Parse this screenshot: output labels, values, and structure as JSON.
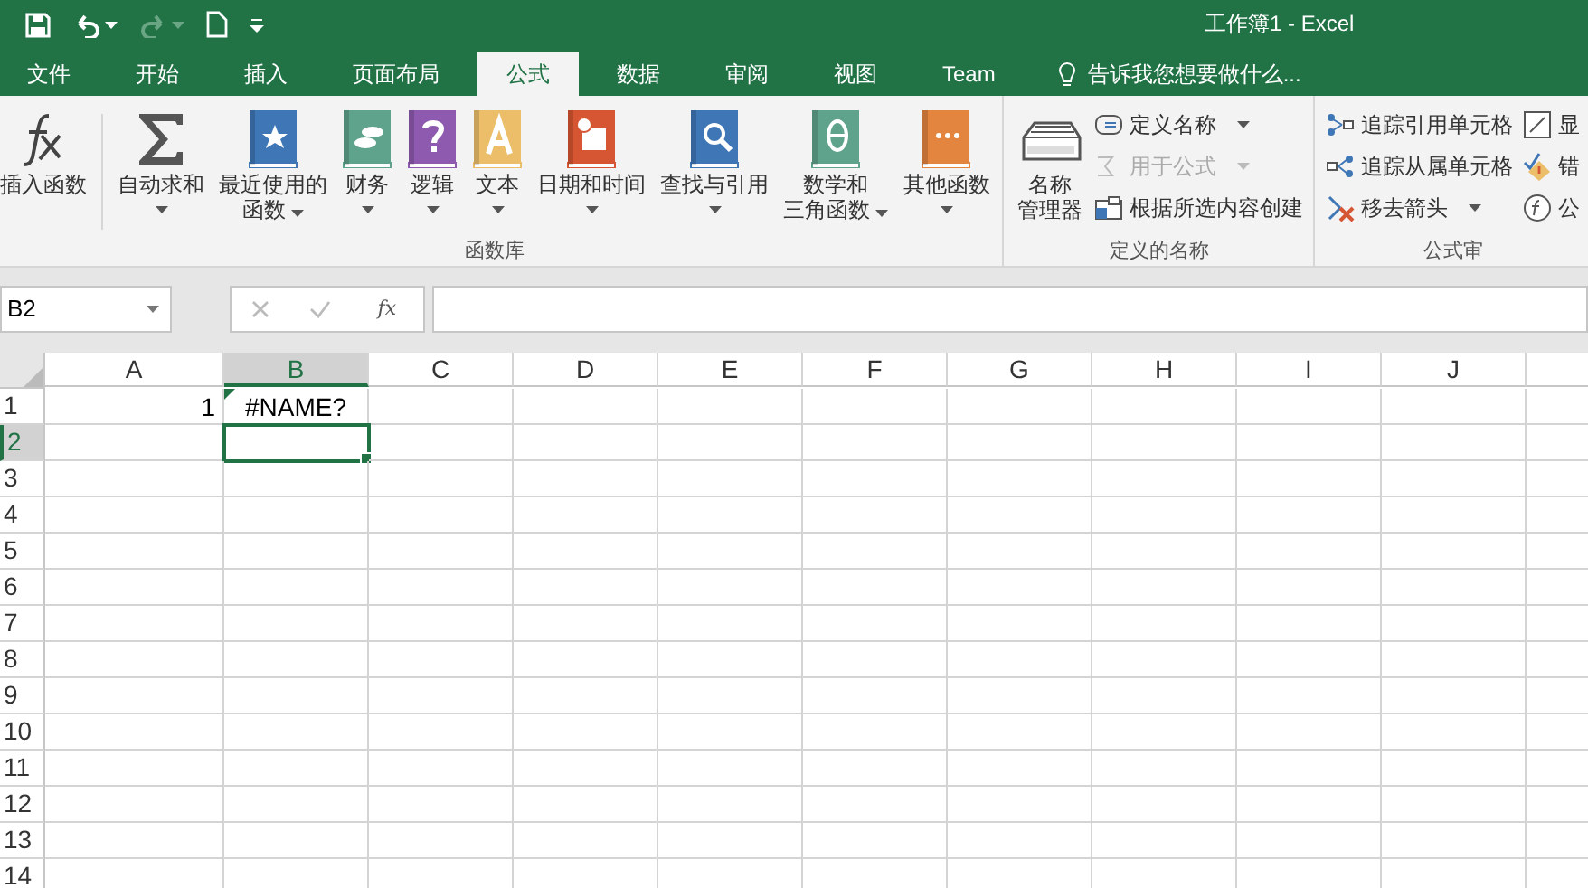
{
  "window": {
    "title": "工作簿1 - Excel"
  },
  "quick_access": [
    {
      "kind": "save",
      "disabled": false
    },
    {
      "kind": "undo",
      "disabled": false
    },
    {
      "kind": "redo",
      "disabled": true
    },
    {
      "kind": "new",
      "disabled": false
    },
    {
      "kind": "customize",
      "disabled": false
    }
  ],
  "tabs": [
    {
      "label": "文件",
      "selected": false
    },
    {
      "label": "开始",
      "selected": false
    },
    {
      "label": "插入",
      "selected": false
    },
    {
      "label": "页面布局",
      "selected": false
    },
    {
      "label": "公式",
      "selected": true
    },
    {
      "label": "数据",
      "selected": false
    },
    {
      "label": "审阅",
      "selected": false
    },
    {
      "label": "视图",
      "selected": false
    },
    {
      "label": "Team",
      "selected": false
    }
  ],
  "tell_me": {
    "placeholder": "告诉我您想要做什么..."
  },
  "ribbon": {
    "groups": [
      {
        "label": "函数库",
        "items": [
          {
            "kind": "large",
            "lines": [
              "插入函数"
            ],
            "dropdown": false
          },
          {
            "kind": "separator"
          },
          {
            "kind": "large",
            "lines": [
              "自动求和"
            ],
            "dropdown": true
          },
          {
            "kind": "large",
            "lines": [
              "最近使用的",
              "函数"
            ],
            "dropdown": true
          },
          {
            "kind": "large",
            "lines": [
              "财务"
            ],
            "dropdown": true
          },
          {
            "kind": "large",
            "lines": [
              "逻辑"
            ],
            "dropdown": true
          },
          {
            "kind": "large",
            "lines": [
              "文本"
            ],
            "dropdown": true
          },
          {
            "kind": "large",
            "lines": [
              "日期和时间"
            ],
            "dropdown": true
          },
          {
            "kind": "large",
            "lines": [
              "查找与引用"
            ],
            "dropdown": true
          },
          {
            "kind": "large",
            "lines": [
              "数学和",
              "三角函数"
            ],
            "dropdown": true
          },
          {
            "kind": "large",
            "lines": [
              "其他函数"
            ],
            "dropdown": true
          }
        ]
      },
      {
        "label": "定义的名称",
        "items": [
          {
            "kind": "large",
            "lines": [
              "名称",
              "管理器"
            ],
            "dropdown": false
          },
          {
            "kind": "small",
            "label": "定义名称",
            "dropdown": true,
            "disabled": false
          },
          {
            "kind": "small",
            "label": "用于公式",
            "dropdown": true,
            "disabled": true
          },
          {
            "kind": "small",
            "label": "根据所选内容创建",
            "dropdown": false,
            "disabled": false
          }
        ]
      },
      {
        "label": "公式审",
        "items": [
          {
            "kind": "small",
            "label": "追踪引用单元格",
            "dropdown": false,
            "disabled": false
          },
          {
            "kind": "small",
            "label": "追踪从属单元格",
            "dropdown": false,
            "disabled": false
          },
          {
            "kind": "small",
            "label": "移去箭头",
            "dropdown": true,
            "disabled": false
          },
          {
            "kind": "small",
            "label": "显",
            "dropdown": false,
            "disabled": false
          },
          {
            "kind": "small",
            "label": "错",
            "dropdown": false,
            "disabled": false
          },
          {
            "kind": "small",
            "label": "公",
            "dropdown": false,
            "disabled": false
          }
        ]
      }
    ]
  },
  "formula_bar": {
    "name_box": "B2",
    "fx": "fx"
  },
  "grid": {
    "columns": [
      {
        "label": "A",
        "selected": false
      },
      {
        "label": "B",
        "selected": true
      },
      {
        "label": "C",
        "selected": false
      },
      {
        "label": "D",
        "selected": false
      },
      {
        "label": "E",
        "selected": false
      },
      {
        "label": "F",
        "selected": false
      },
      {
        "label": "G",
        "selected": false
      },
      {
        "label": "H",
        "selected": false
      },
      {
        "label": "I",
        "selected": false
      },
      {
        "label": "J",
        "selected": false
      }
    ],
    "rows": [
      {
        "label": "1",
        "selected": false,
        "cells": [
          {
            "value": "1",
            "kind": "number"
          },
          {
            "value": "#NAME?",
            "kind": "error"
          }
        ]
      },
      {
        "label": "2",
        "selected": true
      },
      {
        "label": "3",
        "selected": false
      },
      {
        "label": "4",
        "selected": false
      },
      {
        "label": "5",
        "selected": false
      },
      {
        "label": "6",
        "selected": false
      },
      {
        "label": "7",
        "selected": false
      },
      {
        "label": "8",
        "selected": false
      },
      {
        "label": "9",
        "selected": false
      },
      {
        "label": "10",
        "selected": false
      },
      {
        "label": "11",
        "selected": false
      },
      {
        "label": "12",
        "selected": false
      },
      {
        "label": "13",
        "selected": false
      },
      {
        "label": "14",
        "selected": false
      }
    ]
  }
}
